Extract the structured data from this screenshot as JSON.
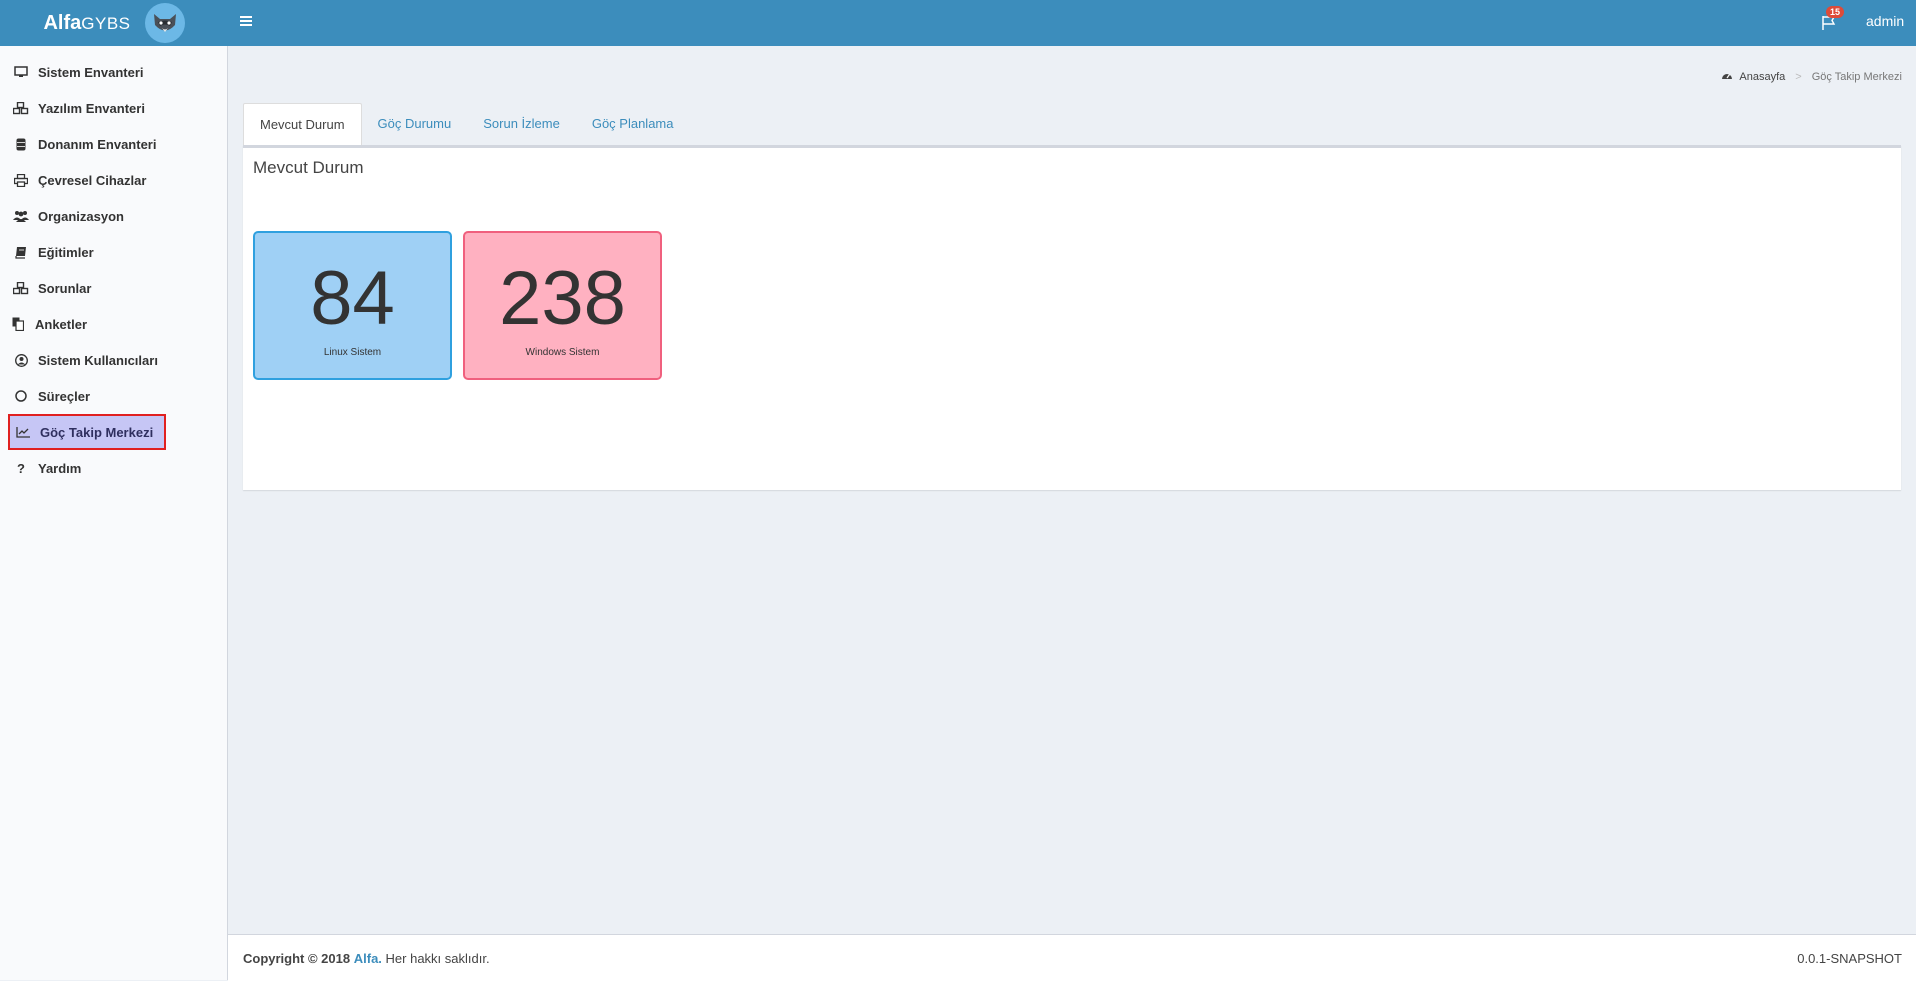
{
  "header": {
    "logo_bold": "Alfa",
    "logo_sub": "GYBS",
    "notification_count": "15",
    "user": "admin"
  },
  "sidebar": {
    "items": [
      {
        "label": "Sistem Envanteri",
        "icon": "monitor-icon"
      },
      {
        "label": "Yazılım Envanteri",
        "icon": "cubes-icon"
      },
      {
        "label": "Donanım Envanteri",
        "icon": "database-icon"
      },
      {
        "label": "Çevresel Cihazlar",
        "icon": "printer-icon"
      },
      {
        "label": "Organizasyon",
        "icon": "users-icon"
      },
      {
        "label": "Eğitimler",
        "icon": "book-icon"
      },
      {
        "label": "Sorunlar",
        "icon": "cubes-icon"
      },
      {
        "label": "Anketler",
        "icon": "copy-icon"
      },
      {
        "label": "Sistem Kullanıcıları",
        "icon": "user-circle-icon"
      },
      {
        "label": "Süreçler",
        "icon": "circle-icon"
      },
      {
        "label": "Göç Takip Merkezi",
        "icon": "line-chart-icon",
        "active": true
      },
      {
        "label": "Yardım",
        "icon": "question-icon"
      }
    ]
  },
  "breadcrumb": {
    "home": "Anasayfa",
    "separator": ">",
    "current": "Göç Takip Merkezi"
  },
  "tabs": [
    {
      "label": "Mevcut Durum",
      "active": true
    },
    {
      "label": "Göç Durumu"
    },
    {
      "label": "Sorun İzleme"
    },
    {
      "label": "Göç Planlama"
    }
  ],
  "panel": {
    "title": "Mevcut Durum",
    "stats": [
      {
        "value": "84",
        "label": "Linux Sistem",
        "color": "#9fd0f5"
      },
      {
        "value": "238",
        "label": "Windows Sistem",
        "color": "#ffb1c1"
      }
    ]
  },
  "footer": {
    "copyright": "Copyright © 2018",
    "brand": "Alfa.",
    "rights": "Her hakkı saklıdır.",
    "version": "0.0.1-SNAPSHOT"
  },
  "colors": {
    "header": "#3c8dbc",
    "active_menu_bg": "#c6c6f5",
    "active_menu_border": "#e02020"
  }
}
